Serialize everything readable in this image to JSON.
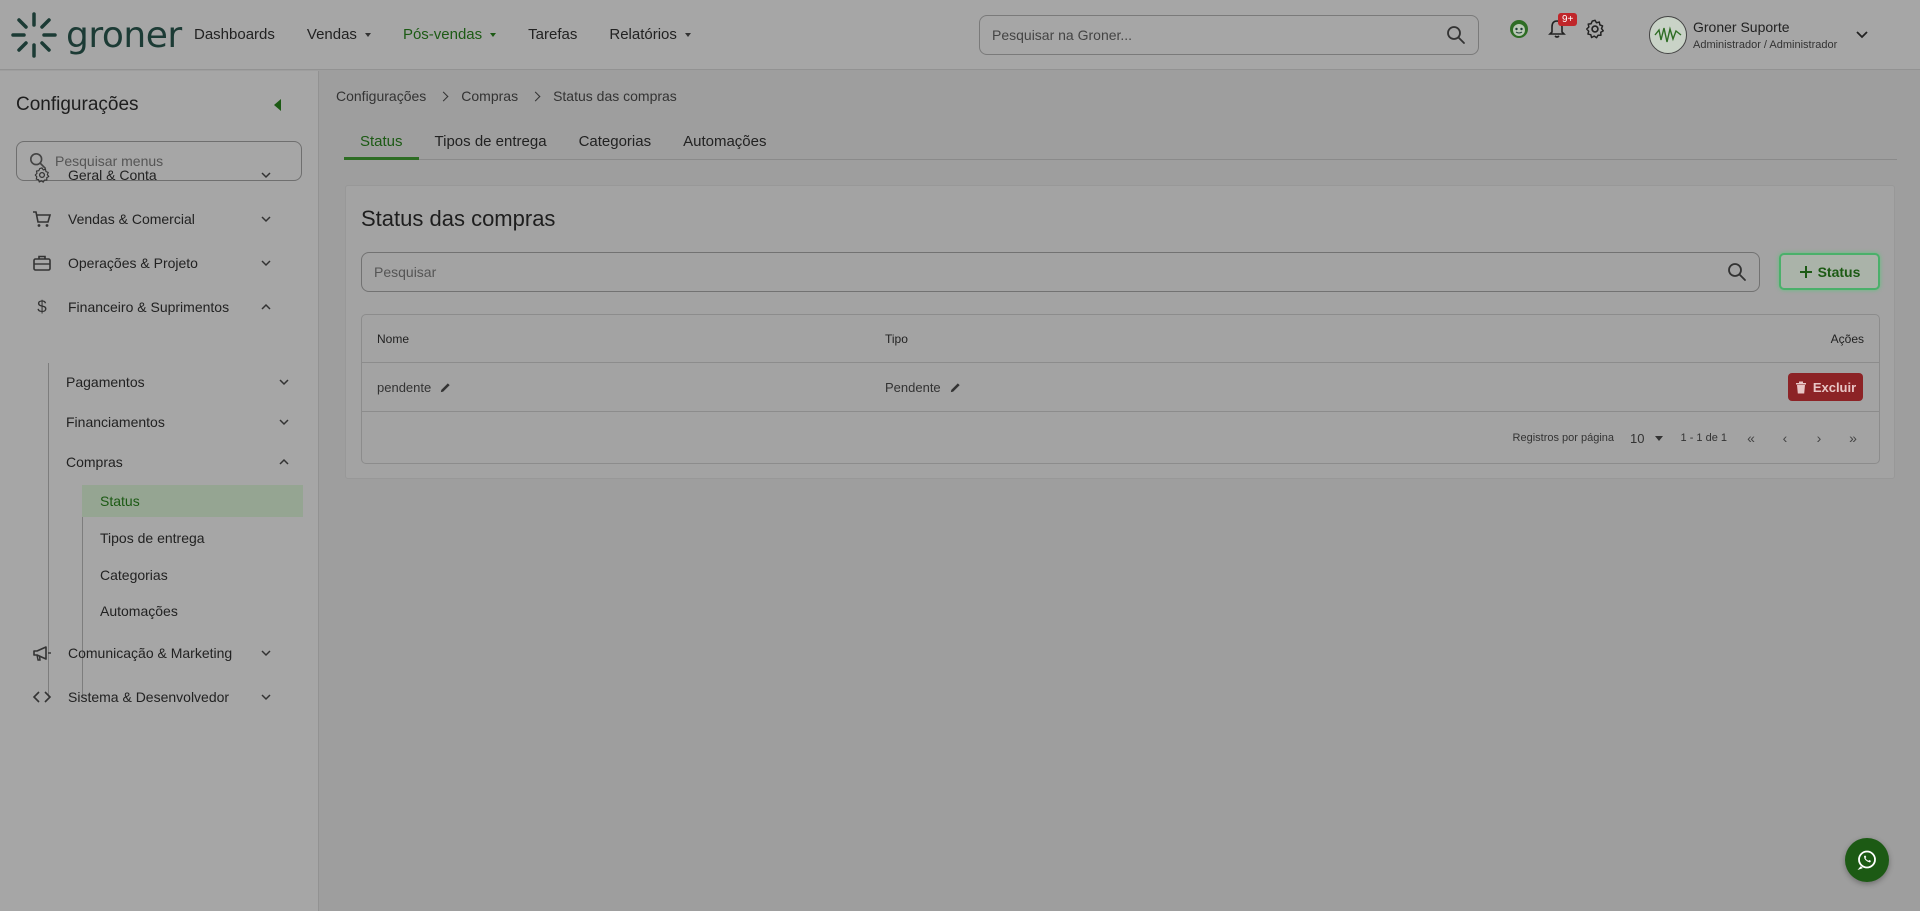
{
  "app": {
    "logo_text": "groner"
  },
  "topnav": [
    {
      "label": "Dashboards",
      "has_caret": false,
      "active": false
    },
    {
      "label": "Vendas",
      "has_caret": true,
      "active": false
    },
    {
      "label": "Pós-vendas",
      "has_caret": true,
      "active": true
    },
    {
      "label": "Tarefas",
      "has_caret": false,
      "active": false
    },
    {
      "label": "Relatórios",
      "has_caret": true,
      "active": false
    }
  ],
  "global_search": {
    "placeholder": "Pesquisar na Groner..."
  },
  "notifications": {
    "badge": "9+"
  },
  "user": {
    "name": "Groner Suporte",
    "role": "Administrador / Administrador"
  },
  "sidebar": {
    "title": "Configurações",
    "search_placeholder": "Pesquisar menus",
    "items": [
      {
        "label": "Geral & Conta",
        "icon": "gear-icon"
      },
      {
        "label": "Vendas & Comercial",
        "icon": "cart-icon"
      },
      {
        "label": "Operações & Projeto",
        "icon": "briefcase-icon"
      },
      {
        "label": "Financeiro & Suprimentos",
        "icon": "dollar-icon"
      },
      {
        "label": "Comunicação & Marketing",
        "icon": "megaphone-icon"
      },
      {
        "label": "Sistema & Desenvolvedor",
        "icon": "code-icon"
      }
    ],
    "financeiro_children": [
      "Pagamentos",
      "Financiamentos",
      "Compras"
    ],
    "compras_children": [
      "Status",
      "Tipos de entrega",
      "Categorias",
      "Automações"
    ]
  },
  "breadcrumb": [
    "Configurações",
    "Compras",
    "Status das compras"
  ],
  "tabs": [
    "Status",
    "Tipos de entrega",
    "Categorias",
    "Automações"
  ],
  "card": {
    "title": "Status das compras",
    "search_placeholder": "Pesquisar",
    "add_button": "Status",
    "columns": [
      "Nome",
      "Tipo",
      "Ações"
    ],
    "rows": [
      {
        "nome": "pendente",
        "tipo": "Pendente",
        "action": "Excluir"
      }
    ],
    "pager": {
      "label": "Registros por página",
      "per_page": "10",
      "range": "1 - 1 de 1"
    }
  },
  "colors": {
    "accent": "#1c5a14",
    "danger": "#8c2326",
    "overlay_bg": "#9e9e9e"
  }
}
